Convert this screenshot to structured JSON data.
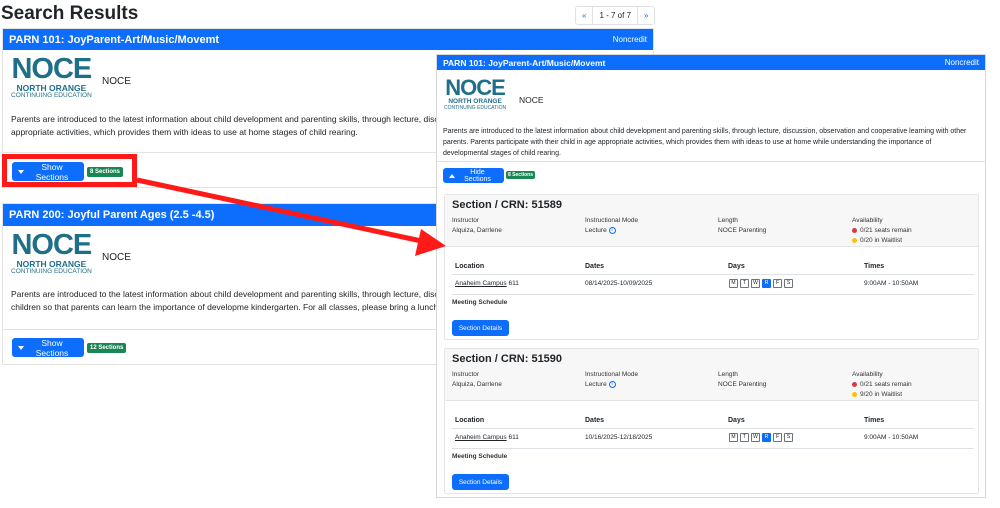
{
  "page": {
    "title": "Search Results"
  },
  "pager": {
    "prev": "«",
    "info": "1 - 7 of 7",
    "next": "»"
  },
  "logo": {
    "main": "NOCE",
    "sub1": "NORTH ORANGE",
    "sub2": "CONTINUING EDUCATION"
  },
  "card1": {
    "title": "PARN 101: JoyParent-Art/Music/Movemt",
    "type": "Noncredit",
    "org": "NOCE",
    "desc": "Parents are introduced to the latest information about child development and parenting skills, through lecture, discus parents. Parents participate with their child in age appropriate activities, which provides them with ideas to use at home stages of child rearing.",
    "button": "Show Sections",
    "badge": "8 Sections"
  },
  "card2": {
    "title": "PARN 200: Joyful Parent Ages (2.5 -4.5)",
    "org": "NOCE",
    "desc": "Parents are introduced to the latest information about child development and parenting skills, through lecture, discus students. Age appropriate activities are offered to the children so that parents can learn the importance of developme kindergarten. For all classes, please bring a lunch.",
    "button": "Show Sections",
    "badge": "12 Sections"
  },
  "panel": {
    "title": "PARN 101: JoyParent-Art/Music/Movemt",
    "type": "Noncredit",
    "org": "NOCE",
    "desc": "Parents are introduced to the latest information about child development and parenting skills, through lecture, discussion, observation and cooperative learning with other parents. Parents participate with their child in age appropriate activities, which provides them with ideas to use at home while understanding the importance of developmental stages of child rearing.",
    "button": "Hide Sections",
    "badge": "8 Sections"
  },
  "labels": {
    "instructor": "Instructor",
    "mode": "Instructional Mode",
    "length": "Length",
    "availability": "Availability",
    "location": "Location",
    "dates": "Dates",
    "days": "Days",
    "times": "Times",
    "meeting": "Meeting Schedule",
    "details": "Section Details",
    "info_glyph": "i"
  },
  "sections": [
    {
      "title": "Section / CRN: 51589",
      "instructor": "Alquiza, Darrlene",
      "mode": "Lecture",
      "length": "NOCE Parenting",
      "seats": "0/21 seats remain",
      "waitlist": "0/20 in Waitlist",
      "location_link": "Anaheim Campus",
      "room": "611",
      "dates": "08/14/2025-10/09/2025",
      "times": "9:00AM - 10:50AM",
      "days": [
        "M",
        "T",
        "W",
        "R",
        "F",
        "S"
      ]
    },
    {
      "title": "Section / CRN: 51590",
      "instructor": "Alquiza, Darrlene",
      "mode": "Lecture",
      "length": "NOCE Parenting",
      "seats": "0/21 seats remain",
      "waitlist": "9/20 in Waitlist",
      "location_link": "Anaheim Campus",
      "room": "611",
      "dates": "10/16/2025-12/18/2025",
      "times": "9:00AM - 10:50AM",
      "days": [
        "M",
        "T",
        "W",
        "R",
        "F",
        "S"
      ]
    }
  ],
  "colors": {
    "primary": "#0d6efd",
    "badge": "#198754",
    "annotation": "#ff1a1a",
    "seat_dot": "#dc3545",
    "waitlist_dot": "#ffc107"
  }
}
